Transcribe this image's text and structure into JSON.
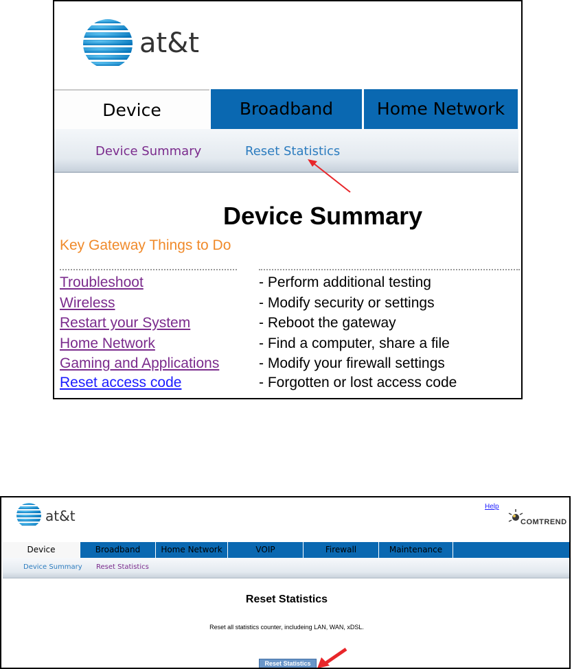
{
  "top": {
    "logo_text": "at&t",
    "tabs": [
      {
        "label": "Device"
      },
      {
        "label": "Broadband"
      },
      {
        "label": "Home Network"
      }
    ],
    "subnav": [
      {
        "label": "Device Summary"
      },
      {
        "label": "Reset Statistics"
      }
    ],
    "heading": "Device Summary",
    "subtitle": "Key Gateway Things to Do",
    "todo": [
      {
        "link": "Troubleshoot",
        "desc": "- Perform additional testing"
      },
      {
        "link": "Wireless",
        "desc": "- Modify security or settings"
      },
      {
        "link": "Restart your System",
        "desc": "- Reboot the gateway"
      },
      {
        "link": "Home Network",
        "desc": "- Find a computer, share a file"
      },
      {
        "link": "Gaming and Applications",
        "desc": "- Modify your firewall settings"
      },
      {
        "link": "Reset access code",
        "desc": "- Forgotten or lost access code"
      }
    ]
  },
  "bottom": {
    "logo_text": "at&t",
    "help": "Help",
    "brand": "COMTREND",
    "tabs": [
      {
        "label": "Device"
      },
      {
        "label": "Broadband"
      },
      {
        "label": "Home Network"
      },
      {
        "label": "VOIP"
      },
      {
        "label": "Firewall"
      },
      {
        "label": "Maintenance"
      }
    ],
    "subnav": [
      {
        "label": "Device Summary"
      },
      {
        "label": "Reset Statistics"
      }
    ],
    "heading": "Reset Statistics",
    "description": "Reset all statistics counter, includeing LAN, WAN, xDSL.",
    "button_label": "Reset Statistics"
  },
  "colors": {
    "tab_blue": "#0a68b1",
    "link_purple": "#7a2a8c",
    "link_blue": "#2c7cbf",
    "accent_orange": "#f08a2a",
    "arrow_red": "#e8262a"
  }
}
